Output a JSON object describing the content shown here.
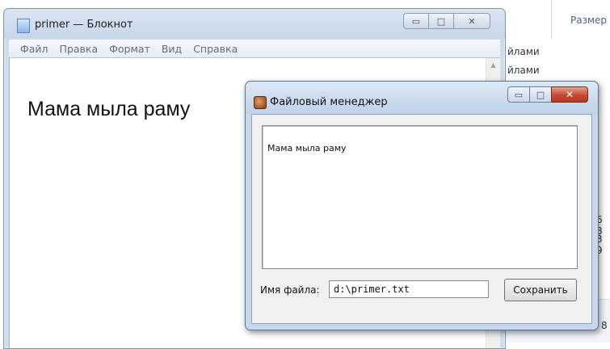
{
  "explorer_bg": {
    "column_header": "Размер",
    "fragments": [
      "йлами",
      "йлами"
    ],
    "numbers": [
      "6 8",
      "3 9",
      "8"
    ]
  },
  "notepad": {
    "title": "primer — Блокнот",
    "menu": [
      "Файл",
      "Правка",
      "Формат",
      "Вид",
      "Справка"
    ],
    "content": "Мама мыла раму"
  },
  "file_manager": {
    "title": "Файловый менеджер",
    "memo_text": "Мама мыла раму",
    "filename_label": "Имя файла:",
    "filename_value": "d:\\primer.txt",
    "save_label": "Сохранить"
  }
}
